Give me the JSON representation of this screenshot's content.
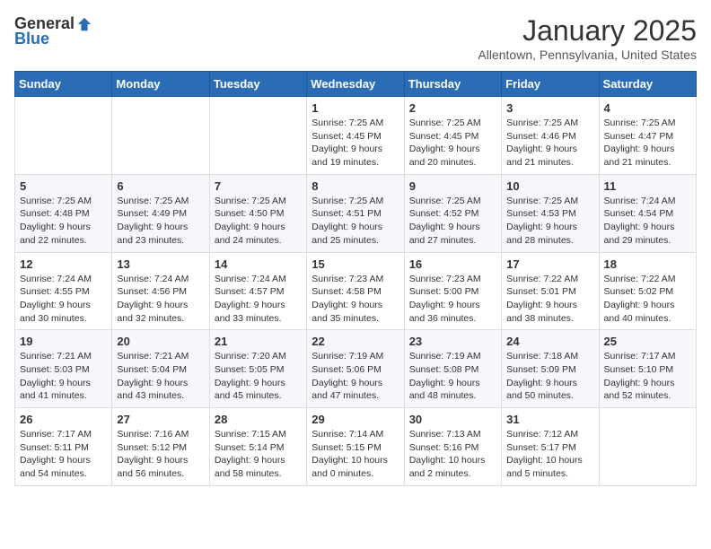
{
  "logo": {
    "general": "General",
    "blue": "Blue"
  },
  "title": "January 2025",
  "location": "Allentown, Pennsylvania, United States",
  "headers": [
    "Sunday",
    "Monday",
    "Tuesday",
    "Wednesday",
    "Thursday",
    "Friday",
    "Saturday"
  ],
  "weeks": [
    [
      {
        "day": "",
        "sunrise": "",
        "sunset": "",
        "daylight": ""
      },
      {
        "day": "",
        "sunrise": "",
        "sunset": "",
        "daylight": ""
      },
      {
        "day": "",
        "sunrise": "",
        "sunset": "",
        "daylight": ""
      },
      {
        "day": "1",
        "sunrise": "Sunrise: 7:25 AM",
        "sunset": "Sunset: 4:45 PM",
        "daylight": "Daylight: 9 hours and 19 minutes."
      },
      {
        "day": "2",
        "sunrise": "Sunrise: 7:25 AM",
        "sunset": "Sunset: 4:45 PM",
        "daylight": "Daylight: 9 hours and 20 minutes."
      },
      {
        "day": "3",
        "sunrise": "Sunrise: 7:25 AM",
        "sunset": "Sunset: 4:46 PM",
        "daylight": "Daylight: 9 hours and 21 minutes."
      },
      {
        "day": "4",
        "sunrise": "Sunrise: 7:25 AM",
        "sunset": "Sunset: 4:47 PM",
        "daylight": "Daylight: 9 hours and 21 minutes."
      }
    ],
    [
      {
        "day": "5",
        "sunrise": "Sunrise: 7:25 AM",
        "sunset": "Sunset: 4:48 PM",
        "daylight": "Daylight: 9 hours and 22 minutes."
      },
      {
        "day": "6",
        "sunrise": "Sunrise: 7:25 AM",
        "sunset": "Sunset: 4:49 PM",
        "daylight": "Daylight: 9 hours and 23 minutes."
      },
      {
        "day": "7",
        "sunrise": "Sunrise: 7:25 AM",
        "sunset": "Sunset: 4:50 PM",
        "daylight": "Daylight: 9 hours and 24 minutes."
      },
      {
        "day": "8",
        "sunrise": "Sunrise: 7:25 AM",
        "sunset": "Sunset: 4:51 PM",
        "daylight": "Daylight: 9 hours and 25 minutes."
      },
      {
        "day": "9",
        "sunrise": "Sunrise: 7:25 AM",
        "sunset": "Sunset: 4:52 PM",
        "daylight": "Daylight: 9 hours and 27 minutes."
      },
      {
        "day": "10",
        "sunrise": "Sunrise: 7:25 AM",
        "sunset": "Sunset: 4:53 PM",
        "daylight": "Daylight: 9 hours and 28 minutes."
      },
      {
        "day": "11",
        "sunrise": "Sunrise: 7:24 AM",
        "sunset": "Sunset: 4:54 PM",
        "daylight": "Daylight: 9 hours and 29 minutes."
      }
    ],
    [
      {
        "day": "12",
        "sunrise": "Sunrise: 7:24 AM",
        "sunset": "Sunset: 4:55 PM",
        "daylight": "Daylight: 9 hours and 30 minutes."
      },
      {
        "day": "13",
        "sunrise": "Sunrise: 7:24 AM",
        "sunset": "Sunset: 4:56 PM",
        "daylight": "Daylight: 9 hours and 32 minutes."
      },
      {
        "day": "14",
        "sunrise": "Sunrise: 7:24 AM",
        "sunset": "Sunset: 4:57 PM",
        "daylight": "Daylight: 9 hours and 33 minutes."
      },
      {
        "day": "15",
        "sunrise": "Sunrise: 7:23 AM",
        "sunset": "Sunset: 4:58 PM",
        "daylight": "Daylight: 9 hours and 35 minutes."
      },
      {
        "day": "16",
        "sunrise": "Sunrise: 7:23 AM",
        "sunset": "Sunset: 5:00 PM",
        "daylight": "Daylight: 9 hours and 36 minutes."
      },
      {
        "day": "17",
        "sunrise": "Sunrise: 7:22 AM",
        "sunset": "Sunset: 5:01 PM",
        "daylight": "Daylight: 9 hours and 38 minutes."
      },
      {
        "day": "18",
        "sunrise": "Sunrise: 7:22 AM",
        "sunset": "Sunset: 5:02 PM",
        "daylight": "Daylight: 9 hours and 40 minutes."
      }
    ],
    [
      {
        "day": "19",
        "sunrise": "Sunrise: 7:21 AM",
        "sunset": "Sunset: 5:03 PM",
        "daylight": "Daylight: 9 hours and 41 minutes."
      },
      {
        "day": "20",
        "sunrise": "Sunrise: 7:21 AM",
        "sunset": "Sunset: 5:04 PM",
        "daylight": "Daylight: 9 hours and 43 minutes."
      },
      {
        "day": "21",
        "sunrise": "Sunrise: 7:20 AM",
        "sunset": "Sunset: 5:05 PM",
        "daylight": "Daylight: 9 hours and 45 minutes."
      },
      {
        "day": "22",
        "sunrise": "Sunrise: 7:19 AM",
        "sunset": "Sunset: 5:06 PM",
        "daylight": "Daylight: 9 hours and 47 minutes."
      },
      {
        "day": "23",
        "sunrise": "Sunrise: 7:19 AM",
        "sunset": "Sunset: 5:08 PM",
        "daylight": "Daylight: 9 hours and 48 minutes."
      },
      {
        "day": "24",
        "sunrise": "Sunrise: 7:18 AM",
        "sunset": "Sunset: 5:09 PM",
        "daylight": "Daylight: 9 hours and 50 minutes."
      },
      {
        "day": "25",
        "sunrise": "Sunrise: 7:17 AM",
        "sunset": "Sunset: 5:10 PM",
        "daylight": "Daylight: 9 hours and 52 minutes."
      }
    ],
    [
      {
        "day": "26",
        "sunrise": "Sunrise: 7:17 AM",
        "sunset": "Sunset: 5:11 PM",
        "daylight": "Daylight: 9 hours and 54 minutes."
      },
      {
        "day": "27",
        "sunrise": "Sunrise: 7:16 AM",
        "sunset": "Sunset: 5:12 PM",
        "daylight": "Daylight: 9 hours and 56 minutes."
      },
      {
        "day": "28",
        "sunrise": "Sunrise: 7:15 AM",
        "sunset": "Sunset: 5:14 PM",
        "daylight": "Daylight: 9 hours and 58 minutes."
      },
      {
        "day": "29",
        "sunrise": "Sunrise: 7:14 AM",
        "sunset": "Sunset: 5:15 PM",
        "daylight": "Daylight: 10 hours and 0 minutes."
      },
      {
        "day": "30",
        "sunrise": "Sunrise: 7:13 AM",
        "sunset": "Sunset: 5:16 PM",
        "daylight": "Daylight: 10 hours and 2 minutes."
      },
      {
        "day": "31",
        "sunrise": "Sunrise: 7:12 AM",
        "sunset": "Sunset: 5:17 PM",
        "daylight": "Daylight: 10 hours and 5 minutes."
      },
      {
        "day": "",
        "sunrise": "",
        "sunset": "",
        "daylight": ""
      }
    ]
  ]
}
